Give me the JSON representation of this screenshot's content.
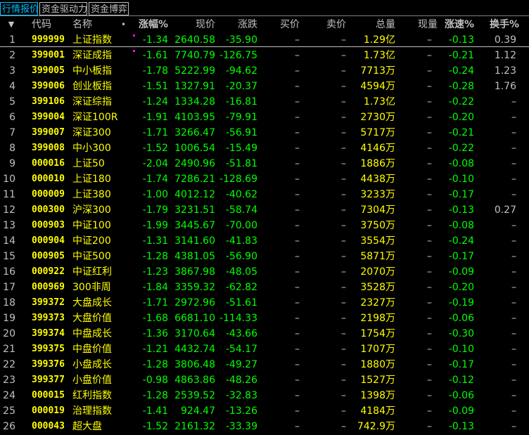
{
  "tabs": [
    {
      "label": "行情报价",
      "active": true
    },
    {
      "label": "资金驱动力",
      "active": false
    },
    {
      "label": "资金博弈",
      "active": false
    }
  ],
  "columns": {
    "sort_icon": "▼",
    "code": "代码",
    "name": "名称",
    "name_marker": "•",
    "pct": "涨幅%",
    "price": "现价",
    "change": "涨跌",
    "bid": "买价",
    "ask": "卖价",
    "volume": "总量",
    "current": "现量",
    "speed": "涨速%",
    "turnover": "换手%"
  },
  "colors": {
    "up": "#ff0000",
    "down": "#00ff00",
    "code": "#ffff00",
    "volume": "#ffff00",
    "tab_active": "#00c0ff"
  },
  "rows": [
    {
      "idx": "1",
      "code": "999999",
      "name": "上证指数",
      "pct": "-1.34",
      "price": "2640.58",
      "chg": "-35.90",
      "bid": "–",
      "ask": "–",
      "vol": "1.29亿",
      "cur": "–",
      "spd": "-0.13",
      "turn": "0.39",
      "marker": true
    },
    {
      "idx": "2",
      "code": "399001",
      "name": "深证成指",
      "pct": "-1.61",
      "price": "7740.79",
      "chg": "-126.75",
      "bid": "–",
      "ask": "–",
      "vol": "1.73亿",
      "cur": "–",
      "spd": "-0.21",
      "turn": "1.12",
      "marker": true
    },
    {
      "idx": "3",
      "code": "399005",
      "name": "中小板指",
      "pct": "-1.78",
      "price": "5222.99",
      "chg": "-94.62",
      "bid": "–",
      "ask": "–",
      "vol": "7713万",
      "cur": "–",
      "spd": "-0.24",
      "turn": "1.23",
      "marker": false
    },
    {
      "idx": "4",
      "code": "399006",
      "name": "创业板指",
      "pct": "-1.51",
      "price": "1327.91",
      "chg": "-20.37",
      "bid": "–",
      "ask": "–",
      "vol": "4594万",
      "cur": "–",
      "spd": "-0.28",
      "turn": "1.76",
      "marker": false
    },
    {
      "idx": "5",
      "code": "399106",
      "name": "深证综指",
      "pct": "-1.24",
      "price": "1334.28",
      "chg": "-16.81",
      "bid": "–",
      "ask": "–",
      "vol": "1.73亿",
      "cur": "–",
      "spd": "-0.22",
      "turn": "–",
      "marker": false
    },
    {
      "idx": "6",
      "code": "399004",
      "name": "深证100R",
      "pct": "-1.91",
      "price": "4103.95",
      "chg": "-79.91",
      "bid": "–",
      "ask": "–",
      "vol": "2730万",
      "cur": "–",
      "spd": "-0.20",
      "turn": "–",
      "marker": false
    },
    {
      "idx": "7",
      "code": "399007",
      "name": "深证300",
      "pct": "-1.71",
      "price": "3266.47",
      "chg": "-56.91",
      "bid": "–",
      "ask": "–",
      "vol": "5717万",
      "cur": "–",
      "spd": "-0.21",
      "turn": "–",
      "marker": false
    },
    {
      "idx": "8",
      "code": "399008",
      "name": "中小300",
      "pct": "-1.52",
      "price": "1006.54",
      "chg": "-15.49",
      "bid": "–",
      "ask": "–",
      "vol": "4146万",
      "cur": "–",
      "spd": "-0.22",
      "turn": "–",
      "marker": false
    },
    {
      "idx": "9",
      "code": "000016",
      "name": "上证50",
      "pct": "-2.04",
      "price": "2490.96",
      "chg": "-51.81",
      "bid": "–",
      "ask": "–",
      "vol": "1886万",
      "cur": "–",
      "spd": "-0.08",
      "turn": "–",
      "marker": false
    },
    {
      "idx": "10",
      "code": "000010",
      "name": "上证180",
      "pct": "-1.74",
      "price": "7286.21",
      "chg": "-128.69",
      "bid": "–",
      "ask": "–",
      "vol": "4438万",
      "cur": "–",
      "spd": "-0.10",
      "turn": "–",
      "marker": false
    },
    {
      "idx": "11",
      "code": "000009",
      "name": "上证380",
      "pct": "-1.00",
      "price": "4012.12",
      "chg": "-40.62",
      "bid": "–",
      "ask": "–",
      "vol": "3233万",
      "cur": "–",
      "spd": "-0.17",
      "turn": "–",
      "marker": false
    },
    {
      "idx": "12",
      "code": "000300",
      "name": "沪深300",
      "pct": "-1.79",
      "price": "3231.51",
      "chg": "-58.74",
      "bid": "–",
      "ask": "–",
      "vol": "7304万",
      "cur": "–",
      "spd": "-0.13",
      "turn": "0.27",
      "marker": false
    },
    {
      "idx": "13",
      "code": "000903",
      "name": "中证100",
      "pct": "-1.99",
      "price": "3445.67",
      "chg": "-70.00",
      "bid": "–",
      "ask": "–",
      "vol": "3750万",
      "cur": "–",
      "spd": "-0.08",
      "turn": "–",
      "marker": false
    },
    {
      "idx": "14",
      "code": "000904",
      "name": "中证200",
      "pct": "-1.31",
      "price": "3141.60",
      "chg": "-41.83",
      "bid": "–",
      "ask": "–",
      "vol": "3554万",
      "cur": "–",
      "spd": "-0.24",
      "turn": "–",
      "marker": false
    },
    {
      "idx": "15",
      "code": "000905",
      "name": "中证500",
      "pct": "-1.28",
      "price": "4381.05",
      "chg": "-56.90",
      "bid": "–",
      "ask": "–",
      "vol": "5871万",
      "cur": "–",
      "spd": "-0.17",
      "turn": "–",
      "marker": false
    },
    {
      "idx": "16",
      "code": "000922",
      "name": "中证红利",
      "pct": "-1.23",
      "price": "3867.98",
      "chg": "-48.05",
      "bid": "–",
      "ask": "–",
      "vol": "2070万",
      "cur": "–",
      "spd": "-0.09",
      "turn": "–",
      "marker": false
    },
    {
      "idx": "17",
      "code": "000969",
      "name": "300非周",
      "pct": "-1.84",
      "price": "3359.32",
      "chg": "-62.82",
      "bid": "–",
      "ask": "–",
      "vol": "3528万",
      "cur": "–",
      "spd": "-0.20",
      "turn": "–",
      "marker": false
    },
    {
      "idx": "18",
      "code": "399372",
      "name": "大盘成长",
      "pct": "-1.71",
      "price": "2972.96",
      "chg": "-51.61",
      "bid": "–",
      "ask": "–",
      "vol": "2327万",
      "cur": "–",
      "spd": "-0.19",
      "turn": "–",
      "marker": false
    },
    {
      "idx": "19",
      "code": "399373",
      "name": "大盘价值",
      "pct": "-1.68",
      "price": "6681.10",
      "chg": "-114.33",
      "bid": "–",
      "ask": "–",
      "vol": "2198万",
      "cur": "–",
      "spd": "-0.06",
      "turn": "–",
      "marker": false
    },
    {
      "idx": "20",
      "code": "399374",
      "name": "中盘成长",
      "pct": "-1.36",
      "price": "3170.64",
      "chg": "-43.66",
      "bid": "–",
      "ask": "–",
      "vol": "1754万",
      "cur": "–",
      "spd": "-0.30",
      "turn": "–",
      "marker": false
    },
    {
      "idx": "21",
      "code": "399375",
      "name": "中盘价值",
      "pct": "-1.21",
      "price": "4432.74",
      "chg": "-54.17",
      "bid": "–",
      "ask": "–",
      "vol": "1707万",
      "cur": "–",
      "spd": "-0.10",
      "turn": "–",
      "marker": false
    },
    {
      "idx": "22",
      "code": "399376",
      "name": "小盘成长",
      "pct": "-1.28",
      "price": "3806.48",
      "chg": "-49.27",
      "bid": "–",
      "ask": "–",
      "vol": "1880万",
      "cur": "–",
      "spd": "-0.17",
      "turn": "–",
      "marker": false
    },
    {
      "idx": "23",
      "code": "399377",
      "name": "小盘价值",
      "pct": "-0.98",
      "price": "4863.86",
      "chg": "-48.26",
      "bid": "–",
      "ask": "–",
      "vol": "1527万",
      "cur": "–",
      "spd": "-0.12",
      "turn": "–",
      "marker": false
    },
    {
      "idx": "24",
      "code": "000015",
      "name": "红利指数",
      "pct": "-1.28",
      "price": "2539.52",
      "chg": "-32.83",
      "bid": "–",
      "ask": "–",
      "vol": "1398万",
      "cur": "–",
      "spd": "-0.06",
      "turn": "–",
      "marker": false
    },
    {
      "idx": "25",
      "code": "000019",
      "name": "治理指数",
      "pct": "-1.41",
      "price": "924.47",
      "chg": "-13.26",
      "bid": "–",
      "ask": "–",
      "vol": "4184万",
      "cur": "–",
      "spd": "-0.09",
      "turn": "–",
      "marker": false
    },
    {
      "idx": "26",
      "code": "000043",
      "name": "超大盘",
      "pct": "-1.52",
      "price": "2161.32",
      "chg": "-33.39",
      "bid": "–",
      "ask": "–",
      "vol": "742.9万",
      "cur": "–",
      "spd": "-0.13",
      "turn": "–",
      "marker": false
    }
  ]
}
